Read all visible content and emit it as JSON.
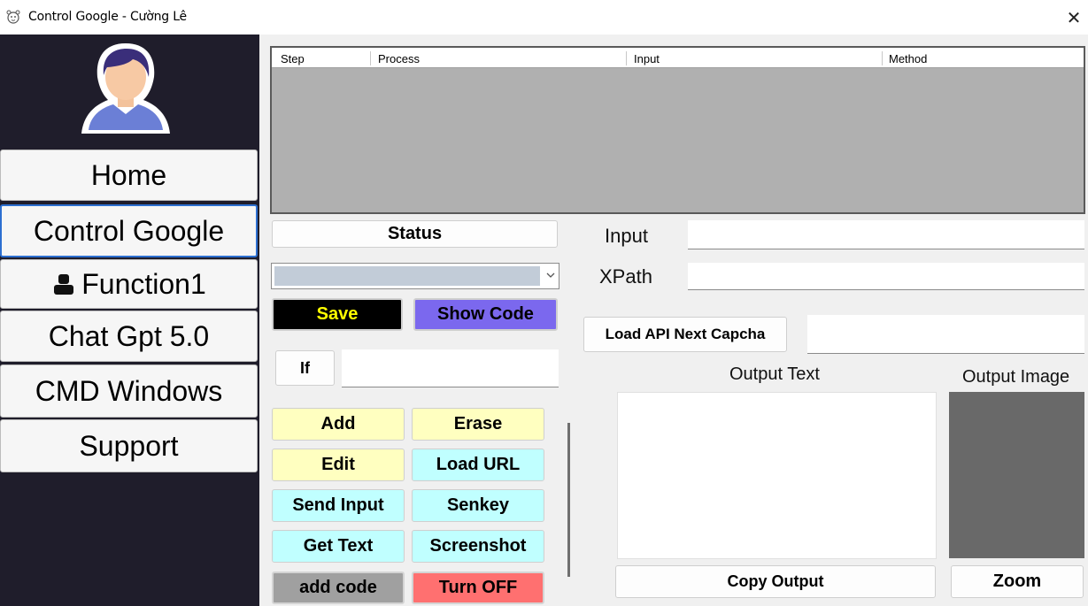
{
  "window": {
    "title": "Control Google - Cường Lê",
    "close_glyph": "✕",
    "app_icon": "tiger-icon"
  },
  "sidebar": {
    "avatar_icon": "user-avatar-icon",
    "items": [
      {
        "label": "Home"
      },
      {
        "label": "Control Google"
      },
      {
        "label": "Function1",
        "icon": "user-icon"
      },
      {
        "label": "Chat Gpt 5.0"
      },
      {
        "label": "CMD Windows"
      },
      {
        "label": "Support"
      }
    ],
    "active_index": 1,
    "colors": {
      "background": "#1f1d2b",
      "item_background": "#f6f6f6",
      "active_border": "#2c6fd1"
    }
  },
  "grid": {
    "columns": [
      "Step",
      "Process",
      "Input",
      "Method"
    ],
    "rows": []
  },
  "controls": {
    "status_label": "Status",
    "combo_value": "",
    "save_label": "Save",
    "show_code_label": "Show Code",
    "if_label": "If",
    "if_value": ""
  },
  "actions": {
    "add": "Add",
    "erase": "Erase",
    "edit": "Edit",
    "load_url": "Load URL",
    "send_input": "Send Input",
    "senkey": "Senkey",
    "get_text": "Get Text",
    "screenshot": "Screenshot",
    "add_code": "add code",
    "turn_off": "Turn OFF"
  },
  "colors": {
    "save_bg": "#000000",
    "save_fg": "#ffff00",
    "show_code_bg": "#7b68ee",
    "yellow_bg": "#ffffc0",
    "cyan_bg": "#c0ffff",
    "gray_bg": "#a0a0a0",
    "red_bg": "#ff7070"
  },
  "form": {
    "input_label": "Input",
    "input_value": "",
    "xpath_label": "XPath",
    "xpath_value": "",
    "load_api_label": "Load API Next Capcha",
    "api_value": ""
  },
  "output": {
    "text_label": "Output Text",
    "text_value": "",
    "image_label": "Output Image",
    "copy_label": "Copy Output",
    "zoom_label": "Zoom"
  }
}
